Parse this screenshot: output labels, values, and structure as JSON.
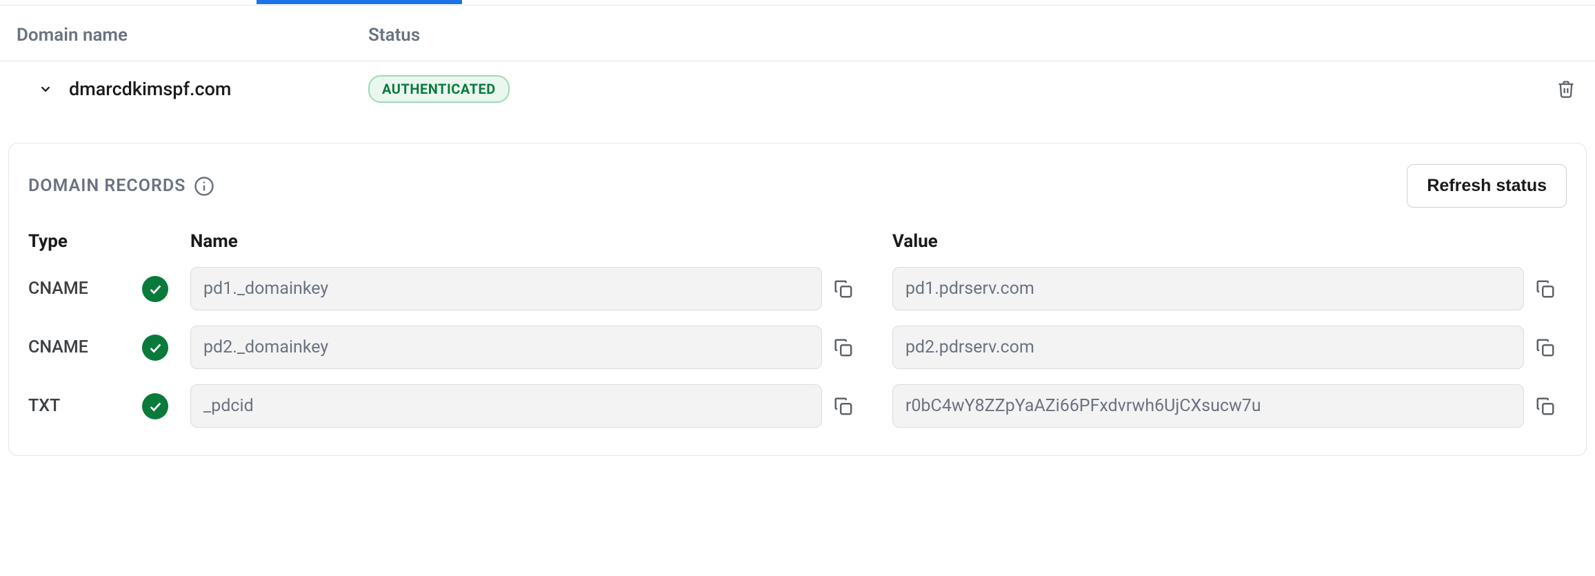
{
  "headers": {
    "domain": "Domain name",
    "status": "Status"
  },
  "domain": {
    "name": "dmarcdkimspf.com",
    "status_label": "AUTHENTICATED"
  },
  "records_panel": {
    "title": "DOMAIN RECORDS",
    "refresh_label": "Refresh status",
    "columns": {
      "type": "Type",
      "name": "Name",
      "value": "Value"
    },
    "rows": [
      {
        "type": "CNAME",
        "name": "pd1._domainkey",
        "value": "pd1.pdrserv.com"
      },
      {
        "type": "CNAME",
        "name": "pd2._domainkey",
        "value": "pd2.pdrserv.com"
      },
      {
        "type": "TXT",
        "name": "_pdcid",
        "value": "r0bC4wY8ZZpYaAZi66PFxdvrwh6UjCXsucw7u"
      }
    ]
  }
}
